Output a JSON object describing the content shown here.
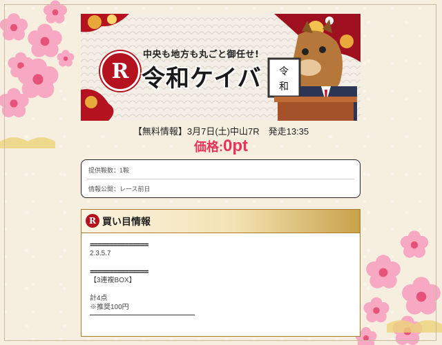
{
  "banner": {
    "tagline": "中央も地方も丸ごと御任せ!",
    "brand": "令和ケイバ",
    "logo_letter": "R",
    "sign_text": "令和",
    "mascot": "horse-mascot-icon"
  },
  "race_info": "【無料情報】3月7日(土)中山7R　発走13:35",
  "price": {
    "label": "価格:",
    "value": "0pt"
  },
  "info_box": {
    "provided_count": "提供鞍数：1鞍",
    "publish_timing": "情報公開：レース前日"
  },
  "buy_section": {
    "title": "買い目情報",
    "icon": "logo-r-icon",
    "separator": "===============",
    "numbers": "2.3.5.7",
    "bet_type": "【3連複BOX】",
    "total": "計4点",
    "recommend": "※推奨100円"
  },
  "colors": {
    "accent_red": "#b4121f",
    "price_pink": "#e8335a",
    "gold": "#c8a24a",
    "background": "#f6efe0"
  }
}
